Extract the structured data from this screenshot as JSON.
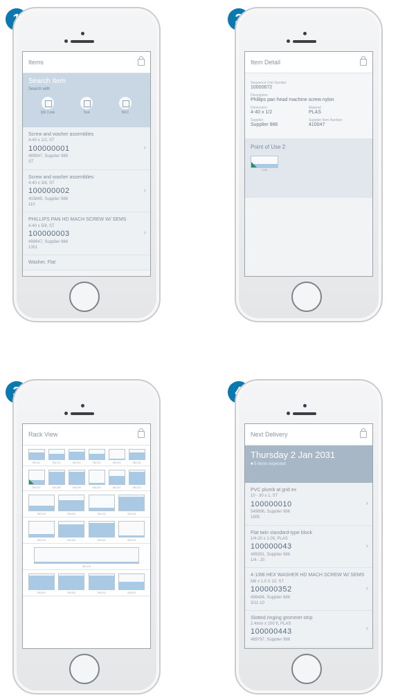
{
  "badges": [
    "1",
    "2",
    "3",
    "4"
  ],
  "phone1": {
    "header": "Items",
    "search_title": "Search Item",
    "search_with": "Search with",
    "icons": [
      {
        "label": "QR Code",
        "icon": "qr-icon"
      },
      {
        "label": "Text",
        "icon": "text-icon"
      },
      {
        "label": "NFC",
        "icon": "nfc-icon"
      }
    ],
    "items": [
      {
        "desc": "Screw and washer assemblies",
        "spec": "4-40 x 1/2, ST",
        "number": "100000001",
        "supplier": "489947, Supplier 986",
        "extra": "ST"
      },
      {
        "desc": "Screw and washer assemblies",
        "spec": "4-40 x 3/8, ST",
        "number": "100000002",
        "supplier": "403845, Supplier 986",
        "extra": "110"
      },
      {
        "desc": "PHILLIPS PAN HD MACH SCREW W/ SEMS",
        "spec": "4-40 x 5/8, ST",
        "number": "100000003",
        "supplier": "499947, Supplier 986",
        "extra": "1301"
      }
    ],
    "cutoff": "Washer, Flat"
  },
  "phone2": {
    "header": "Item Detail",
    "f1_label": "Sequence Unit Number",
    "f1_value": "10000672",
    "f2_label": "Description",
    "f2_value": "Phillips pan head machine screw nylon",
    "f3_label": "Dimension",
    "f3_value": "4-40 x 1/2",
    "f4_label": "Material",
    "f4_value": "PLAS",
    "f5_label": "Supplier",
    "f5_value": "Supplier 986",
    "f6_label": "Supplier Item Number",
    "f6_value": "410047",
    "pou_title": "Point of Use 2",
    "bin_label": "1/28",
    "bin_fill": 0.3
  },
  "phone3": {
    "header": "Rack View",
    "rows": [
      {
        "bins": [
          {
            "l": "SM-111",
            "f": 0.7
          },
          {
            "l": "SM-112",
            "f": 0.6
          },
          {
            "l": "SM-113",
            "f": 0.8
          },
          {
            "l": "SM-114",
            "f": 0.6
          },
          {
            "l": "SM-115",
            "f": 0.1
          },
          {
            "l": "SM-116",
            "f": 0.7
          }
        ]
      },
      {
        "bins": [
          {
            "l": "SM-207",
            "f": 0.3
          },
          {
            "l": "SM-208",
            "f": 0.9
          },
          {
            "l": "SM-209",
            "f": 0.9
          },
          {
            "l": "SM-210",
            "f": 0.1
          },
          {
            "l": "SM-211",
            "f": 0.6
          },
          {
            "l": "SM-212",
            "f": 0.9
          }
        ]
      },
      {
        "bins": [
          {
            "l": "SM-310",
            "f": 0.3
          },
          {
            "l": "SM-311",
            "f": 0.7
          },
          {
            "l": "SM-312",
            "f": 0.2
          },
          {
            "l": "SM-313",
            "f": 0.9
          }
        ]
      },
      {
        "bins": [
          {
            "l": "SM-419",
            "f": 0.2
          },
          {
            "l": "SM-420",
            "f": 0.8
          },
          {
            "l": "SM-421",
            "f": 0.9
          },
          {
            "l": "SM-422",
            "f": 0.1
          }
        ]
      },
      {
        "bins": [
          {
            "l": "SM-123",
            "f": 0.1
          }
        ]
      },
      {
        "bins": [
          {
            "l": "SM-510",
            "f": 0.9
          },
          {
            "l": "SM-511",
            "f": 0.9
          },
          {
            "l": "SM-512",
            "f": 0.9
          },
          {
            "l": "SM-513",
            "f": 0.5
          }
        ]
      }
    ]
  },
  "phone4": {
    "header": "Next Delivery",
    "date": "Thursday 2 Jan 2031",
    "sub": "5 items expected",
    "items": [
      {
        "desc": "PVC plumb at grid ex",
        "spec": "10 - 30 x 1, ST",
        "number": "100000010",
        "supplier": "549896, Supplier 986",
        "extra": "1605"
      },
      {
        "desc": "Flat twin standard-type block",
        "spec": "1/4-20 x 1.00, PLAS",
        "number": "100000043",
        "supplier": "499391, Supplier 986",
        "extra": "1/4 - 20"
      },
      {
        "desc": "4-1/8B HEX WASHER HD MACH SCREW W/ SEMS",
        "spec": "M6 x 1.0 X 10, ST",
        "number": "100000352",
        "supplier": "499494, Supplier 986",
        "extra": "3/11-10"
      },
      {
        "desc": "Slotted ringing grommet strip",
        "spec": "2.4mm x 100 ft, PLAS",
        "number": "100000443",
        "supplier": "489797, Supplier 986",
        "extra": ""
      }
    ]
  }
}
